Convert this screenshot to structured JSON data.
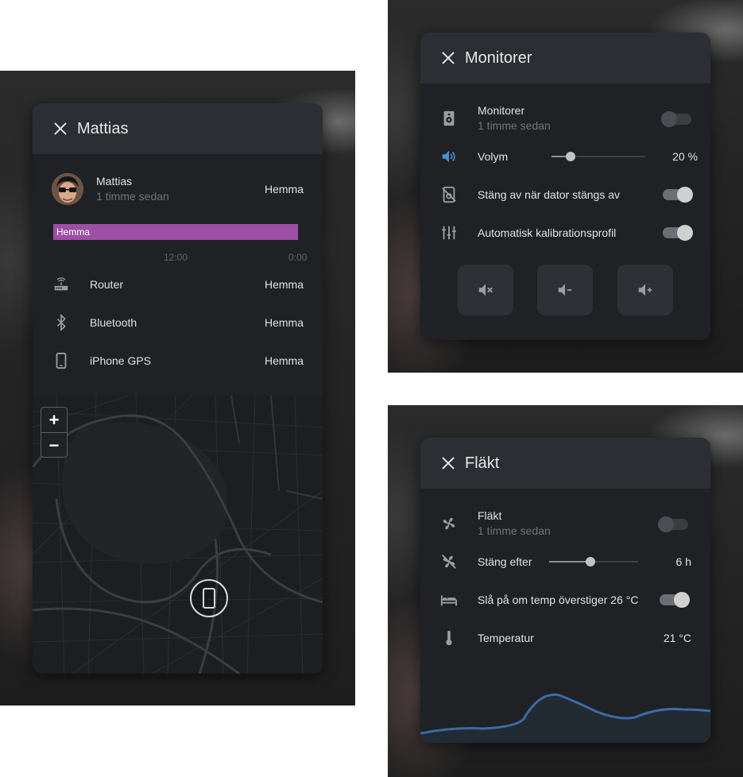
{
  "person_card": {
    "title": "Mattias",
    "person": {
      "name": "Mattias",
      "last_changed": "1 timme sedan",
      "state": "Hemma"
    },
    "timeline": {
      "label": "Hemma",
      "color": "#9c4fa4",
      "ticks": [
        "12:00",
        "0:00"
      ]
    },
    "trackers": [
      {
        "icon": "router-icon",
        "label": "Router",
        "state": "Hemma"
      },
      {
        "icon": "bluetooth-icon",
        "label": "Bluetooth",
        "state": "Hemma"
      },
      {
        "icon": "cellphone-icon",
        "label": "iPhone GPS",
        "state": "Hemma"
      }
    ],
    "map": {
      "zoom_in": "+",
      "zoom_out": "−",
      "marker_icon": "cellphone-icon"
    }
  },
  "monitor_card": {
    "title": "Monitorer",
    "entity": {
      "name": "Monitorer",
      "last_changed": "1 timme sedan",
      "state": "off"
    },
    "volume": {
      "label": "Volym",
      "value": "20 %",
      "level": 0.2,
      "accent": "#4a90d9"
    },
    "rows": [
      {
        "icon": "speaker-off-icon",
        "label": "Stäng av när dator stängs av",
        "state": "on"
      },
      {
        "icon": "tune-vertical-icon",
        "label": "Automatisk kalibrationsprofil",
        "state": "on"
      }
    ],
    "buttons": [
      {
        "icon": "volume-mute-icon",
        "label": "mute"
      },
      {
        "icon": "volume-minus-icon",
        "label": "volume down"
      },
      {
        "icon": "volume-plus-icon",
        "label": "volume up"
      }
    ]
  },
  "fan_card": {
    "title": "Fläkt",
    "entity": {
      "name": "Fläkt",
      "last_changed": "1 timme sedan",
      "state": "off"
    },
    "timer": {
      "label": "Stäng efter",
      "value": "6 h",
      "level": 0.46
    },
    "temp_switch": {
      "label": "Slå på om temp överstiger 26 °C",
      "state": "on"
    },
    "temperature": {
      "label": "Temperatur",
      "value": "21 °C"
    },
    "graph_color": "#3d6aa8"
  }
}
